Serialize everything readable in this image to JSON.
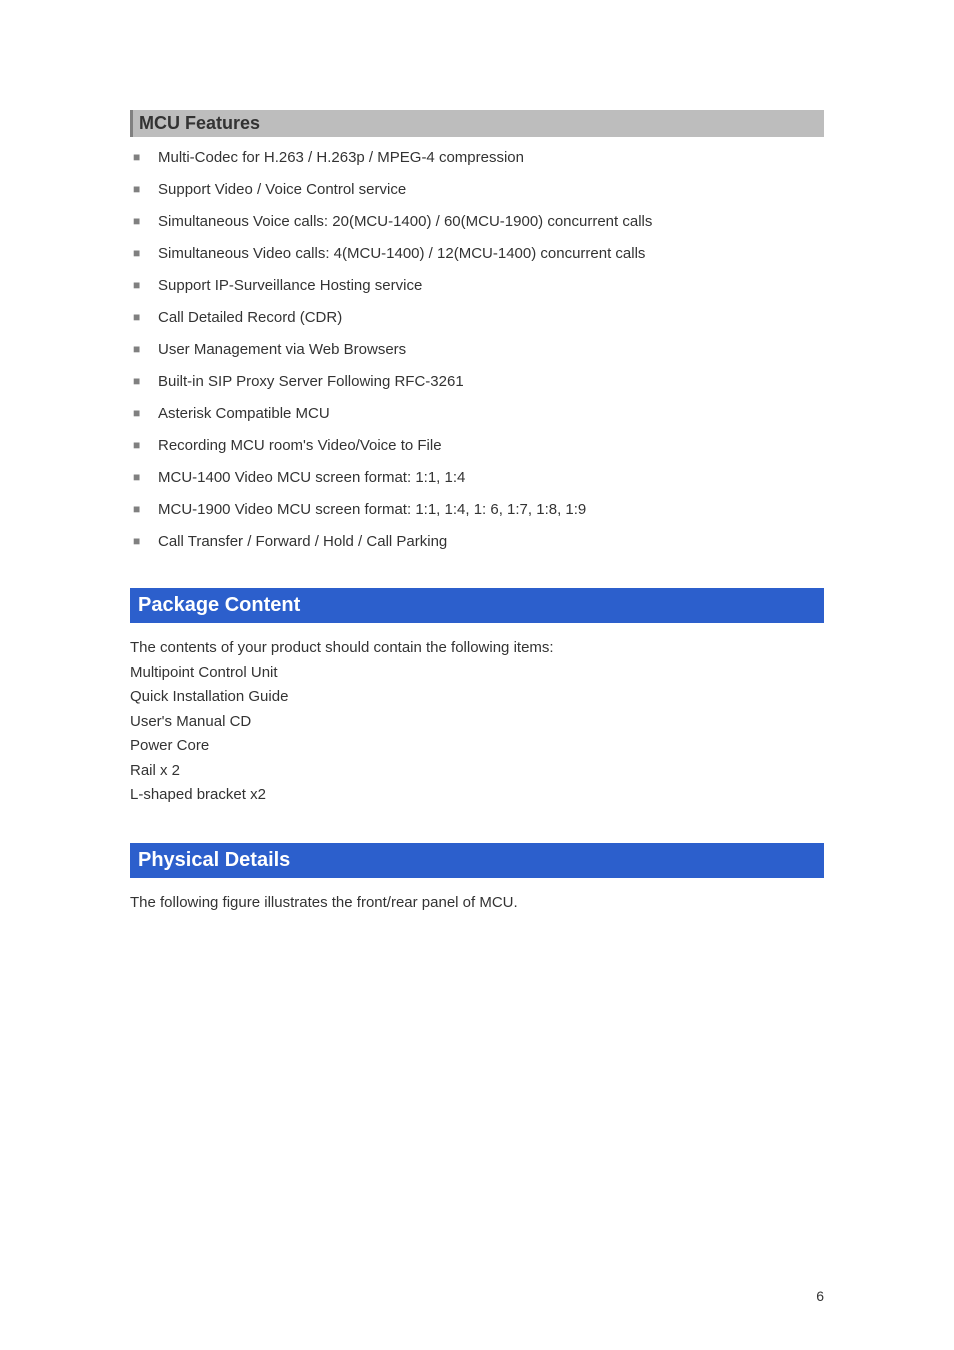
{
  "headings": {
    "mcu_features": "MCU Features",
    "package_content": "Package Content",
    "physical_details": "Physical Details"
  },
  "mcu_features_items": [
    "Multi-Codec for H.263 / H.263p / MPEG-4 compression",
    "Support Video / Voice Control service",
    "Simultaneous Voice calls: 20(MCU-1400) / 60(MCU-1900) concurrent calls",
    "Simultaneous Video calls: 4(MCU-1400) / 12(MCU-1400) concurrent calls",
    "Support IP-Surveillance Hosting service",
    "Call Detailed Record (CDR)",
    "User Management via Web Browsers",
    "Built-in SIP Proxy Server Following RFC-3261",
    "Asterisk Compatible MCU",
    "Recording MCU room's Video/Voice to File",
    "MCU-1400 Video MCU screen format: 1:1, 1:4",
    "MCU-1900 Video MCU screen format: 1:1, 1:4, 1: 6, 1:7, 1:8, 1:9",
    "Call Transfer / Forward / Hold / Call Parking"
  ],
  "package_content_lines": [
    "The contents of your product should contain the following items:",
    "Multipoint Control Unit",
    "Quick Installation Guide",
    "User's Manual CD",
    "Power Core",
    "Rail x 2",
    "L-shaped bracket x2"
  ],
  "physical_details_text": "The following figure illustrates the front/rear panel of MCU.",
  "page_number": "6"
}
